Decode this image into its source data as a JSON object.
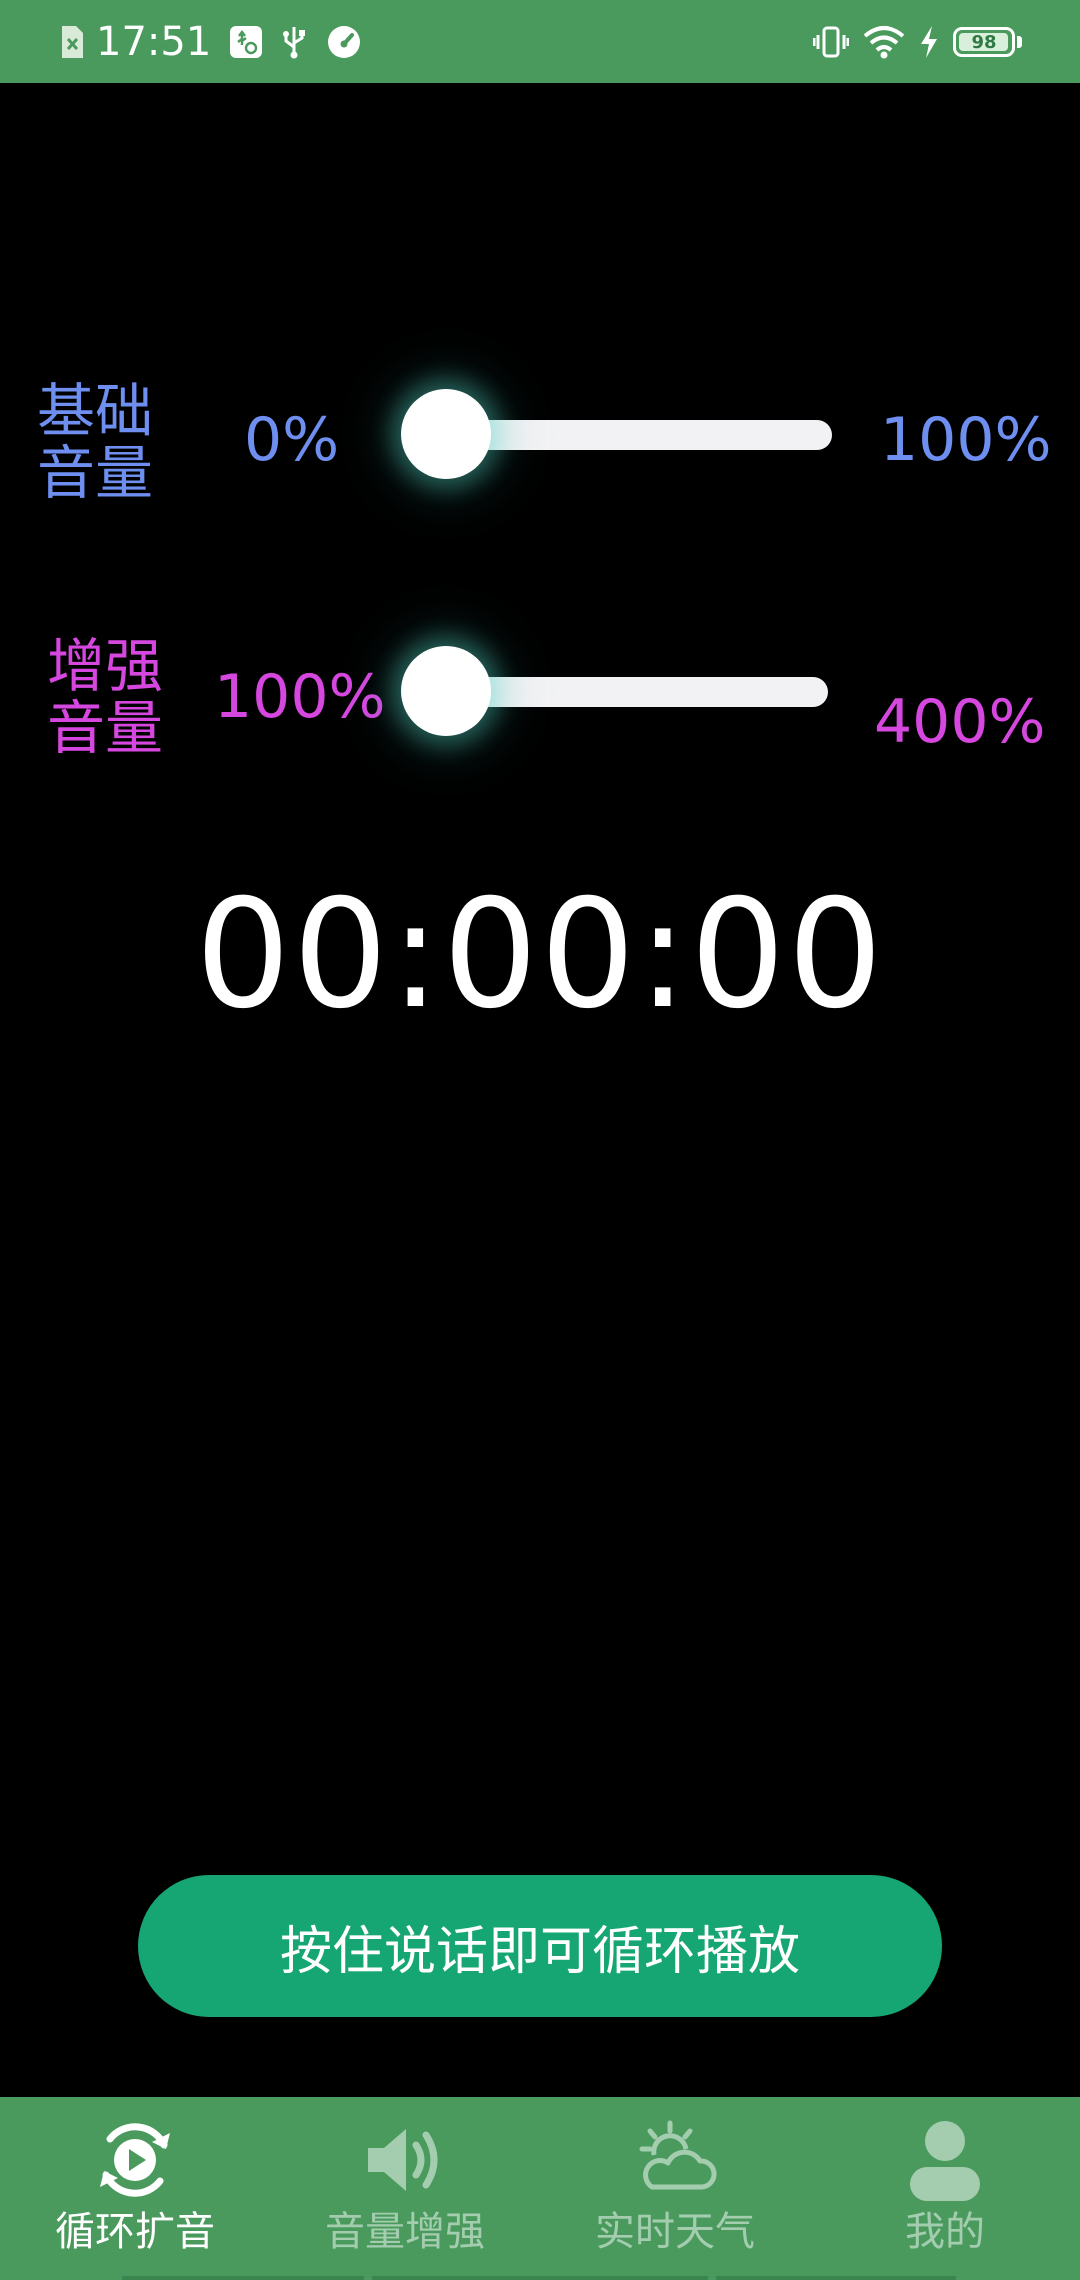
{
  "status_bar": {
    "time": "17:51",
    "battery": "98",
    "battery_level": 0.98,
    "left_icons": [
      "sim-off-icon",
      "usb-settings-icon",
      "usb-icon",
      "speed-icon"
    ],
    "right_icons": [
      "vibrate-icon",
      "wifi-icon",
      "charging-icon",
      "battery-icon"
    ],
    "bg_color": "#4a9a5d"
  },
  "base_volume": {
    "label_line1": "基础",
    "label_line2": "音量",
    "min_label": "0%",
    "max_label": "100%",
    "value": 0,
    "color": "#6f8ff0"
  },
  "boost_volume": {
    "label_line1": "增强",
    "label_line2": "音量",
    "min_label": "100%",
    "max_label": "400%",
    "value": 100,
    "color": "#d647df"
  },
  "timer": "00:00:00",
  "main_button": {
    "label": "按住说话即可循环播放",
    "color": "#16a673"
  },
  "bottom_nav": {
    "items": [
      {
        "label": "循环扩音",
        "icon": "loop-play-icon",
        "active": true
      },
      {
        "label": "音量增强",
        "icon": "speaker-icon",
        "active": false
      },
      {
        "label": "实时天气",
        "icon": "weather-icon",
        "active": false
      },
      {
        "label": "我的",
        "icon": "profile-icon",
        "active": false
      }
    ]
  }
}
